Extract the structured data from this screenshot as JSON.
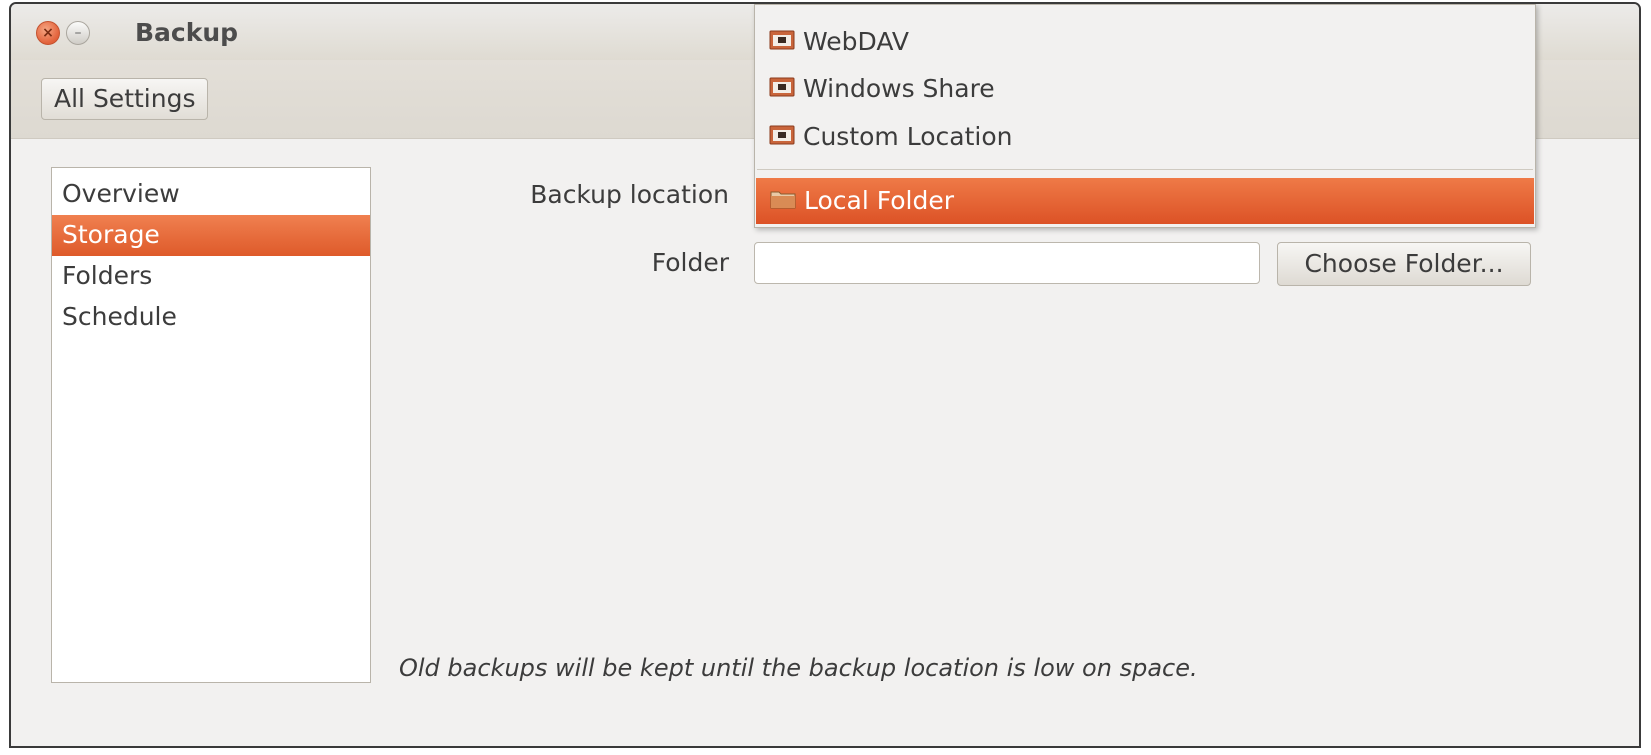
{
  "window": {
    "title": "Backup",
    "close_glyph": "×",
    "minimize_glyph": "–"
  },
  "toolbar": {
    "all_settings_label": "All Settings"
  },
  "sidebar": {
    "items": [
      {
        "label": "Overview"
      },
      {
        "label": "Storage",
        "selected": true
      },
      {
        "label": "Folders"
      },
      {
        "label": "Schedule"
      }
    ]
  },
  "form": {
    "backup_location_label": "Backup location",
    "folder_label": "Folder",
    "folder_value": "",
    "choose_folder_label": "Choose Folder...",
    "note": "Old backups will be kept until the backup location is low on space."
  },
  "location_menu": {
    "items": [
      {
        "label": "WebDAV",
        "icon": "network-folder-icon"
      },
      {
        "label": "Windows Share",
        "icon": "network-folder-icon"
      },
      {
        "label": "Custom Location",
        "icon": "network-folder-icon"
      },
      {
        "label": "Local Folder",
        "icon": "folder-icon",
        "selected": true
      }
    ]
  },
  "colors": {
    "accent": "#de5a2a",
    "window_bg": "#f2f1f0"
  }
}
